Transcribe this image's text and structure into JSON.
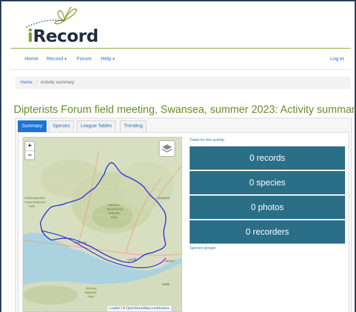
{
  "logo": {
    "i": "i",
    "rest": "Record"
  },
  "nav": {
    "home": "Home",
    "record": "Record",
    "forum": "Forum",
    "help": "Help",
    "login": "Log in"
  },
  "breadcrumb": {
    "home": "Home",
    "current": "Activity summary"
  },
  "page_title": "Dipterists Forum field meeting, Swansea, summer 2023: Activity summary",
  "tabs": [
    "Summary",
    "Species",
    "League Tables",
    "Trending"
  ],
  "map": {
    "zoom_in": "+",
    "zoom_out": "−",
    "attrib_leaflet": "Leaflet",
    "attrib_sep": " | © ",
    "attrib_osm": "OpenStreetMap contributors",
    "place_labels": [
      "Swansea",
      "Cardiff",
      "Bristol",
      "Hereford",
      "Wells",
      "Brecon Beacons National Park",
      "Exmoor National Park",
      "Pembrokeshire Coast National Park"
    ]
  },
  "totals": {
    "heading": "Totals for this activity",
    "records": "0 records",
    "species": "0 species",
    "photos": "0 photos",
    "recorders": "0 recorders",
    "species_groups": "Species groups"
  },
  "colors": {
    "accent_green": "#6a8b26",
    "stat_bg": "#2a6f87",
    "link_blue": "#2a72b5",
    "tab_active": "#1a74d4",
    "boundary": "#2233dd"
  }
}
